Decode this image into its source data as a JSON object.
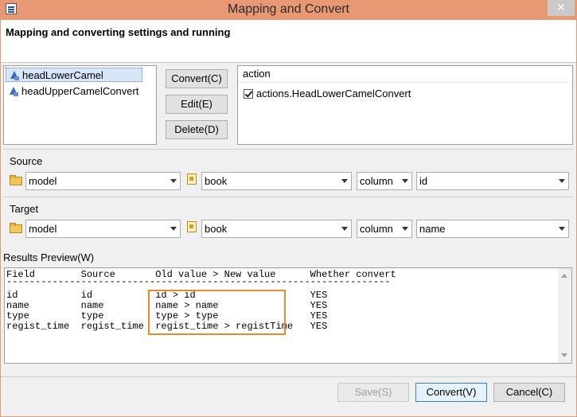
{
  "window": {
    "title": "Mapping and Convert",
    "close_glyph": "✕"
  },
  "banner": {
    "text": "Mapping and converting settings and running"
  },
  "tree": {
    "items": [
      {
        "label": "headLowerCamel",
        "selected": true
      },
      {
        "label": "headUpperCamelConvert",
        "selected": false
      }
    ]
  },
  "buttons": {
    "convert": "Convert(C)",
    "edit": "Edit(E)",
    "delete": "Delete(D)"
  },
  "action": {
    "header": "action",
    "items": [
      {
        "label": "actions.HeadLowerCamelConvert",
        "checked": true
      }
    ]
  },
  "source": {
    "label": "Source",
    "model": "model",
    "table": "book",
    "column_kind": "column",
    "column": "id"
  },
  "target": {
    "label": "Target",
    "model": "model",
    "table": "book",
    "column_kind": "column",
    "column": "name"
  },
  "results": {
    "label": "Results Preview(W)",
    "header": "Field        Source       Old value > New value      Whether convert",
    "divider": "-------------------------------------------------------------------",
    "rows": [
      "id           id           id > id                    YES",
      "name         name         name > name                YES",
      "type         type         type > type                YES",
      "regist_time  regist_time  regist_time > registTime   YES"
    ]
  },
  "footer": {
    "save": "Save(S)",
    "convert": "Convert(V)",
    "cancel": "Cancel(C)"
  },
  "colors": {
    "titlebar": "#e89872",
    "highlight": "#ef8a2c"
  }
}
